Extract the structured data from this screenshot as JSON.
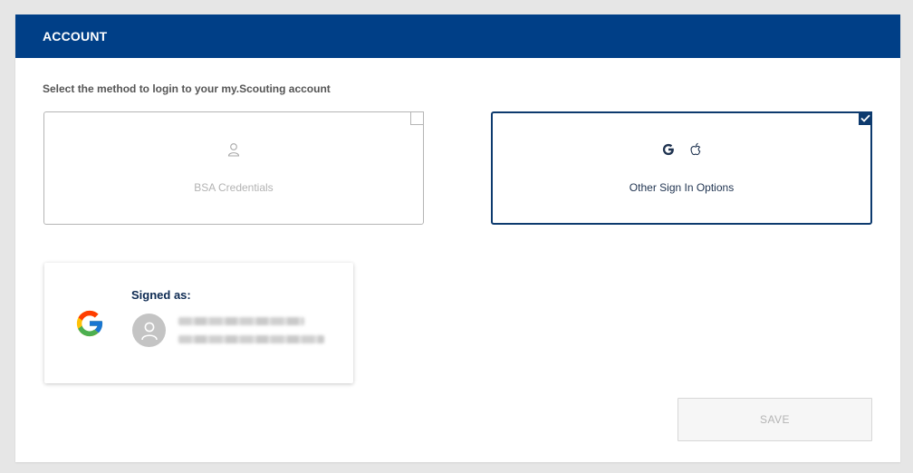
{
  "header": {
    "title": "ACCOUNT"
  },
  "instruction": "Select the method to login to your my.Scouting account",
  "options": [
    {
      "label": "BSA Credentials",
      "selected": false,
      "icon": "user-outline-icon"
    },
    {
      "label": "Other Sign In Options",
      "selected": true,
      "icons": [
        "google-g-icon",
        "apple-icon"
      ]
    }
  ],
  "signed_in": {
    "title": "Signed as:",
    "provider_icon": "google-logo-icon",
    "avatar_icon": "user-avatar-icon"
  },
  "save_button": {
    "label": "SAVE",
    "enabled": false
  },
  "colors": {
    "header_bg": "#003f87",
    "selected_border": "#0d3a6e",
    "unselected_border": "#b5b5b5",
    "muted_text": "#b3b3b3"
  }
}
